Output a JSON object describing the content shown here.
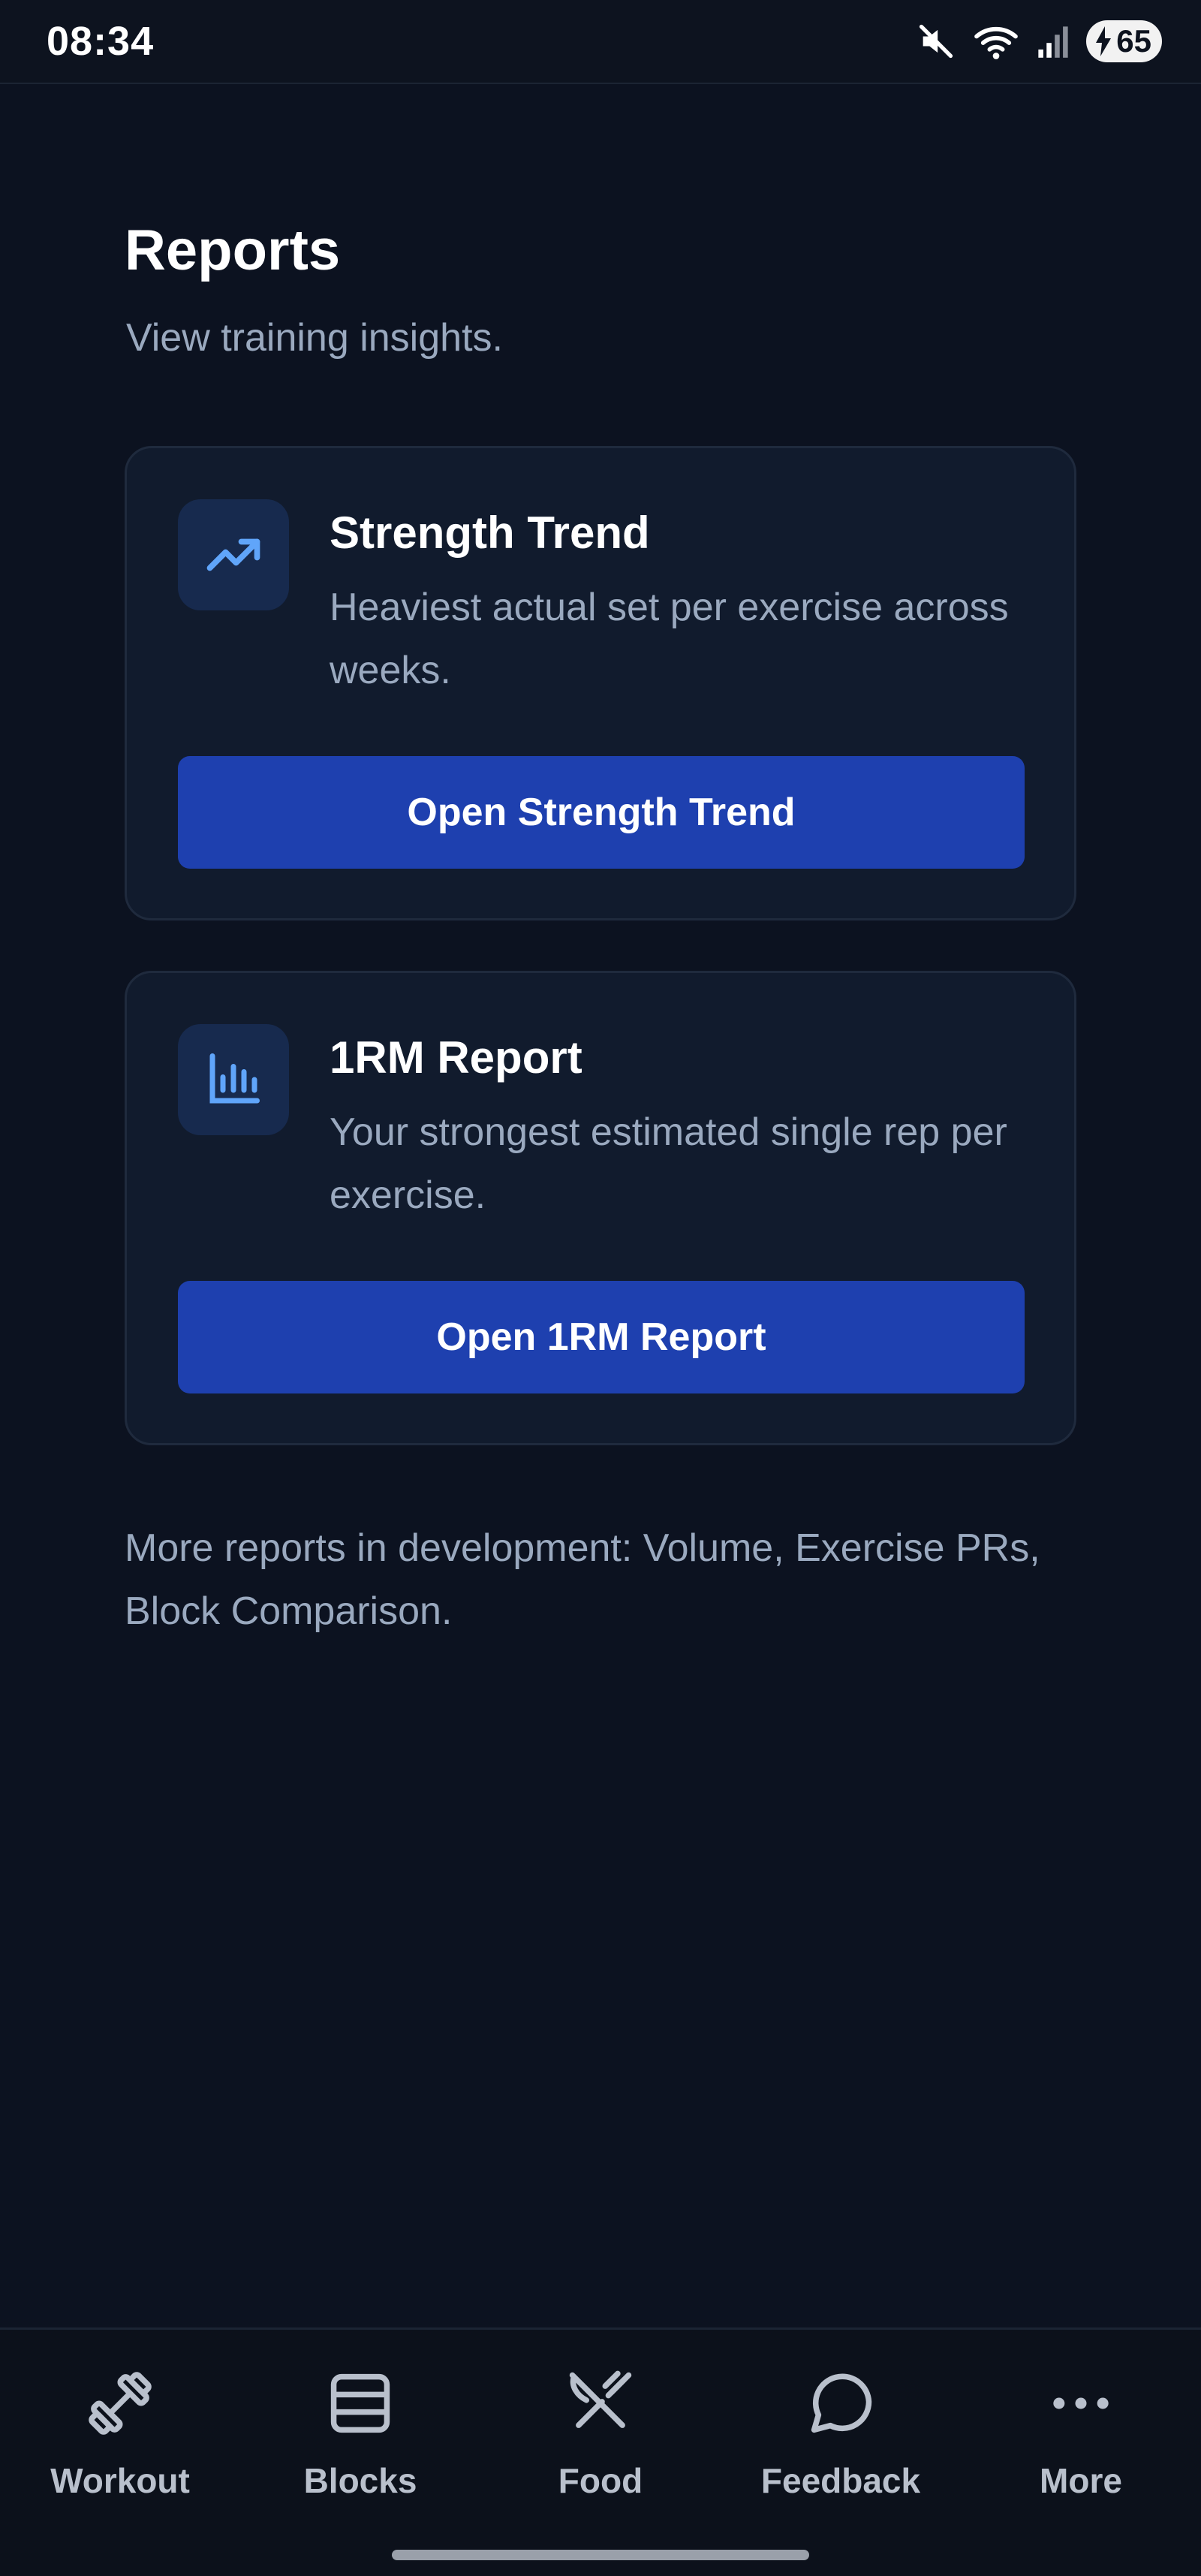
{
  "status_bar": {
    "time": "08:34",
    "battery_level": "65",
    "icons": [
      "mute-icon",
      "wifi-icon",
      "signal-icon",
      "battery-charging-icon"
    ]
  },
  "page": {
    "title": "Reports",
    "subtitle": "View training insights."
  },
  "reports": [
    {
      "icon": "trending-up-icon",
      "title": "Strength Trend",
      "description": "Heaviest actual set per exercise across weeks.",
      "button_label": "Open Strength Trend"
    },
    {
      "icon": "bar-chart-icon",
      "title": "1RM Report",
      "description": "Your strongest estimated single rep per exercise.",
      "button_label": "Open 1RM Report"
    }
  ],
  "footnote": "More reports in development: Volume, Exercise PRs, Block Comparison.",
  "bottom_nav": {
    "items": [
      {
        "label": "Workout",
        "icon": "dumbbell-icon"
      },
      {
        "label": "Blocks",
        "icon": "blocks-icon"
      },
      {
        "label": "Food",
        "icon": "fork-knife-icon"
      },
      {
        "label": "Feedback",
        "icon": "chat-bubble-icon"
      },
      {
        "label": "More",
        "icon": "more-dots-icon"
      }
    ]
  },
  "colors": {
    "background": "#0c1220",
    "card": "#111b2d",
    "accent_button": "#1e40af",
    "icon_tile": "#172a4e",
    "icon_accent": "#60a5fa",
    "muted_text": "#9aa9bf"
  }
}
